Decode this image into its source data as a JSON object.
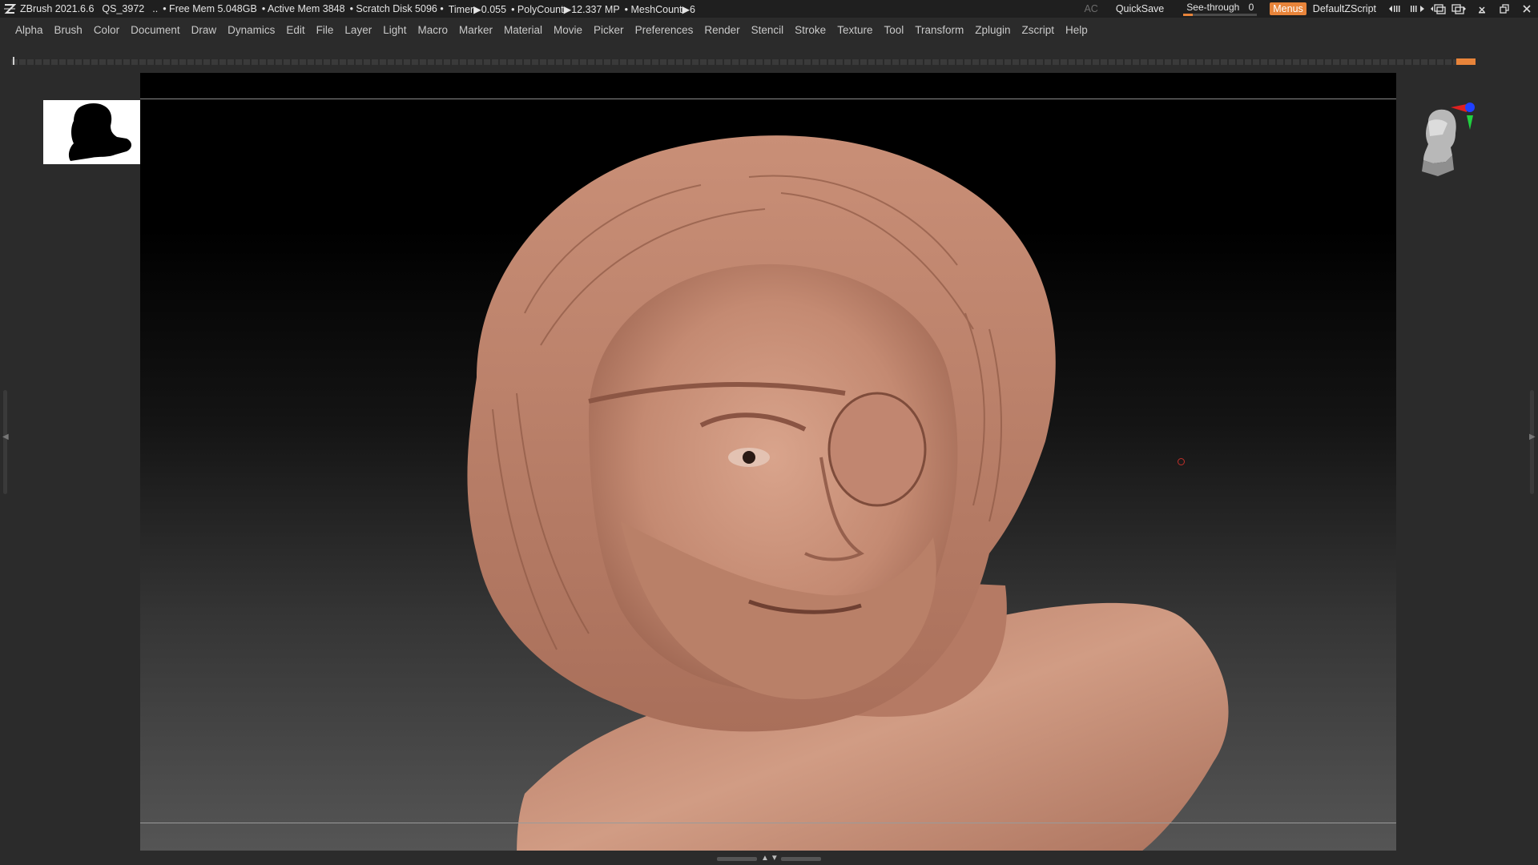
{
  "titlebar": {
    "app": "ZBrush 2021.6.6",
    "project": "QS_3972",
    "dots": "..",
    "free_mem": "• Free Mem 5.048GB",
    "active_mem": "• Active Mem 3848",
    "scratch": "• Scratch Disk 5096 •",
    "timer": "Timer▶0.055",
    "polycount": "• PolyCount▶12.337 MP",
    "meshcount": "• MeshCount▶6",
    "ac": "AC",
    "quicksave": "QuickSave",
    "seethrough_label": "See-through",
    "seethrough_value": "0",
    "seethrough_level": 0,
    "menus": "Menus",
    "default_zscript": "DefaultZScript"
  },
  "menubar": {
    "items": [
      "Alpha",
      "Brush",
      "Color",
      "Document",
      "Draw",
      "Dynamics",
      "Edit",
      "File",
      "Layer",
      "Light",
      "Macro",
      "Marker",
      "Material",
      "Movie",
      "Picker",
      "Preferences",
      "Render",
      "Stencil",
      "Stroke",
      "Texture",
      "Tool",
      "Transform",
      "Zplugin",
      "Zscript",
      "Help"
    ]
  },
  "colors": {
    "accent": "#e8843a",
    "background": "#2b2b2b",
    "skin": "#c98f77",
    "gizmo_x": "#e02020",
    "gizmo_y": "#20d040",
    "gizmo_z": "#2040ff"
  },
  "icons": {
    "zbrush_logo": "zbrush-logo-icon",
    "navigation": "navigation-head-icon",
    "silhouette": "silhouette-icon"
  }
}
